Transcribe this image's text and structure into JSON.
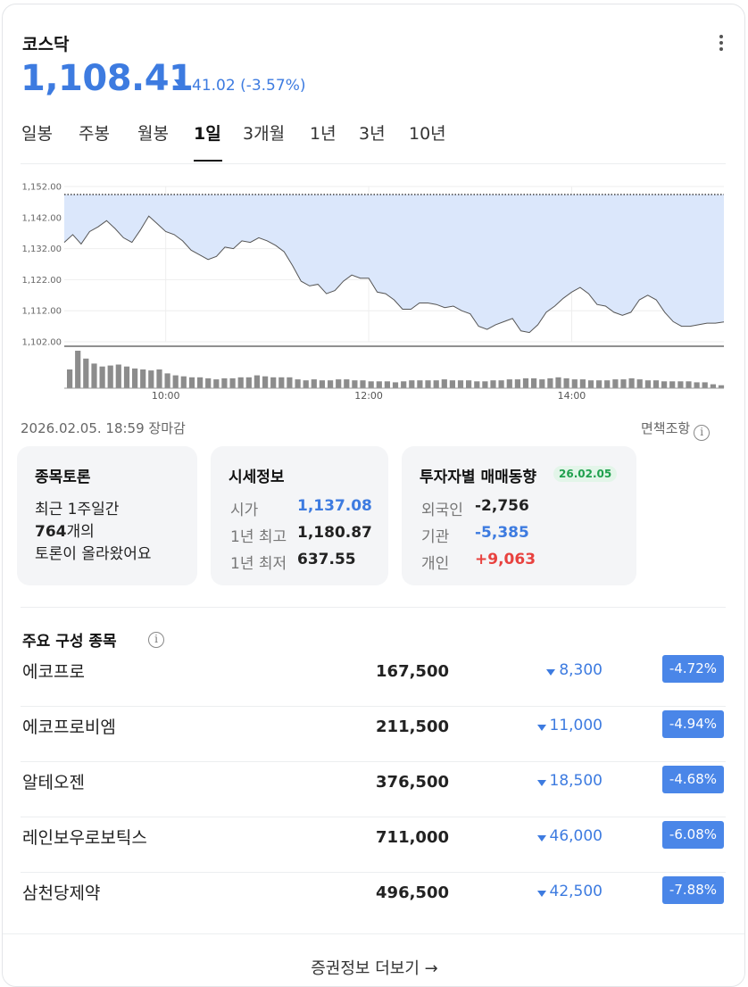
{
  "header": {
    "title": "코스닥",
    "price": "1,108.41",
    "change": "41.02 (-3.57%)",
    "direction": "down"
  },
  "tabs": [
    {
      "label": "일봉",
      "active": false
    },
    {
      "label": "주봉",
      "active": false
    },
    {
      "label": "월봉",
      "active": false
    },
    {
      "label": "1일",
      "active": true
    },
    {
      "label": "3개월",
      "active": false
    },
    {
      "label": "1년",
      "active": false
    },
    {
      "label": "3년",
      "active": false
    },
    {
      "label": "10년",
      "active": false
    }
  ],
  "chart_data": {
    "type": "area",
    "title": "",
    "y_ticks": [
      "1,152.00",
      "1,142.00",
      "1,132.00",
      "1,122.00",
      "1,112.00",
      "1,102.00"
    ],
    "ylim": [
      1102,
      1152
    ],
    "x_ticks": [
      "10:00",
      "12:00",
      "14:00"
    ],
    "reference_line": 1149.43,
    "price_series": [
      {
        "t": "09:00",
        "v": 1134.0
      },
      {
        "t": "09:05",
        "v": 1136.5
      },
      {
        "t": "09:10",
        "v": 1133.5
      },
      {
        "t": "09:15",
        "v": 1137.5
      },
      {
        "t": "09:20",
        "v": 1139.0
      },
      {
        "t": "09:25",
        "v": 1141.0
      },
      {
        "t": "09:30",
        "v": 1138.5
      },
      {
        "t": "09:35",
        "v": 1135.5
      },
      {
        "t": "09:40",
        "v": 1134.0
      },
      {
        "t": "09:45",
        "v": 1138.0
      },
      {
        "t": "09:50",
        "v": 1142.5
      },
      {
        "t": "09:55",
        "v": 1140.0
      },
      {
        "t": "10:00",
        "v": 1137.5
      },
      {
        "t": "10:05",
        "v": 1136.5
      },
      {
        "t": "10:10",
        "v": 1134.5
      },
      {
        "t": "10:15",
        "v": 1131.5
      },
      {
        "t": "10:20",
        "v": 1130.0
      },
      {
        "t": "10:25",
        "v": 1128.5
      },
      {
        "t": "10:30",
        "v": 1129.5
      },
      {
        "t": "10:35",
        "v": 1132.5
      },
      {
        "t": "10:40",
        "v": 1132.0
      },
      {
        "t": "10:45",
        "v": 1134.5
      },
      {
        "t": "10:50",
        "v": 1134.0
      },
      {
        "t": "10:55",
        "v": 1135.5
      },
      {
        "t": "11:00",
        "v": 1134.5
      },
      {
        "t": "11:05",
        "v": 1133.0
      },
      {
        "t": "11:10",
        "v": 1131.0
      },
      {
        "t": "11:15",
        "v": 1126.5
      },
      {
        "t": "11:20",
        "v": 1121.5
      },
      {
        "t": "11:25",
        "v": 1120.0
      },
      {
        "t": "11:30",
        "v": 1120.5
      },
      {
        "t": "11:35",
        "v": 1117.5
      },
      {
        "t": "11:40",
        "v": 1118.5
      },
      {
        "t": "11:45",
        "v": 1121.5
      },
      {
        "t": "11:50",
        "v": 1123.5
      },
      {
        "t": "11:55",
        "v": 1122.5
      },
      {
        "t": "12:00",
        "v": 1122.5
      },
      {
        "t": "12:05",
        "v": 1118.0
      },
      {
        "t": "12:10",
        "v": 1117.5
      },
      {
        "t": "12:15",
        "v": 1115.5
      },
      {
        "t": "12:20",
        "v": 1112.5
      },
      {
        "t": "12:25",
        "v": 1112.5
      },
      {
        "t": "12:30",
        "v": 1114.5
      },
      {
        "t": "12:35",
        "v": 1114.5
      },
      {
        "t": "12:40",
        "v": 1114.0
      },
      {
        "t": "12:45",
        "v": 1113.0
      },
      {
        "t": "12:50",
        "v": 1113.5
      },
      {
        "t": "12:55",
        "v": 1112.0
      },
      {
        "t": "13:00",
        "v": 1111.0
      },
      {
        "t": "13:05",
        "v": 1107.0
      },
      {
        "t": "13:10",
        "v": 1106.0
      },
      {
        "t": "13:15",
        "v": 1107.5
      },
      {
        "t": "13:20",
        "v": 1108.5
      },
      {
        "t": "13:25",
        "v": 1109.5
      },
      {
        "t": "13:30",
        "v": 1105.5
      },
      {
        "t": "13:35",
        "v": 1105.0
      },
      {
        "t": "13:40",
        "v": 1107.5
      },
      {
        "t": "13:45",
        "v": 1111.5
      },
      {
        "t": "13:50",
        "v": 1113.5
      },
      {
        "t": "13:55",
        "v": 1116.0
      },
      {
        "t": "14:00",
        "v": 1118.0
      },
      {
        "t": "14:05",
        "v": 1119.5
      },
      {
        "t": "14:10",
        "v": 1117.5
      },
      {
        "t": "14:15",
        "v": 1114.0
      },
      {
        "t": "14:20",
        "v": 1113.5
      },
      {
        "t": "14:25",
        "v": 1111.5
      },
      {
        "t": "14:30",
        "v": 1110.5
      },
      {
        "t": "14:35",
        "v": 1111.5
      },
      {
        "t": "14:40",
        "v": 1115.5
      },
      {
        "t": "14:45",
        "v": 1117.0
      },
      {
        "t": "14:50",
        "v": 1115.5
      },
      {
        "t": "14:55",
        "v": 1111.5
      },
      {
        "t": "15:00",
        "v": 1108.5
      },
      {
        "t": "15:05",
        "v": 1107.0
      },
      {
        "t": "15:10",
        "v": 1107.0
      },
      {
        "t": "15:15",
        "v": 1107.5
      },
      {
        "t": "15:20",
        "v": 1108.0
      },
      {
        "t": "15:25",
        "v": 1108.0
      },
      {
        "t": "15:30",
        "v": 1108.41
      }
    ],
    "volume_series": [
      19,
      38,
      30,
      25,
      22,
      23,
      24,
      22,
      20,
      19,
      18,
      19,
      15,
      13,
      12,
      11,
      11,
      10,
      9,
      10,
      10,
      11,
      11,
      13,
      12,
      11,
      11,
      11,
      9,
      8,
      9,
      8,
      8,
      9,
      9,
      8,
      8,
      7,
      7,
      7,
      6,
      7,
      8,
      8,
      8,
      8,
      9,
      8,
      8,
      8,
      7,
      7,
      8,
      8,
      9,
      9,
      10,
      10,
      9,
      10,
      11,
      10,
      9,
      9,
      8,
      8,
      8,
      9,
      9,
      10,
      9,
      8,
      8,
      7,
      7,
      7,
      7,
      6,
      6,
      4,
      3
    ]
  },
  "status": {
    "timestamp": "2026.02.05. 18:59 장마감",
    "disclaimer": "면책조항",
    "info_glyph": "i"
  },
  "discussion": {
    "title": "종목토론",
    "line1": "최근 1주일간",
    "count": "764",
    "count_suffix": "개의",
    "line3": "토론이 올라왔어요"
  },
  "quote_info": {
    "title": "시세정보",
    "rows": [
      {
        "label": "시가",
        "value": "1,137.08",
        "color": "blue"
      },
      {
        "label": "1년 최고",
        "value": "1,180.87",
        "color": "default"
      },
      {
        "label": "1년 최저",
        "value": "637.55",
        "color": "default"
      }
    ]
  },
  "investor_trend": {
    "title": "투자자별 매매동향",
    "date": "26.02.05",
    "rows": [
      {
        "label": "외국인",
        "value": "-2,756",
        "color": "default"
      },
      {
        "label": "기관",
        "value": "-5,385",
        "color": "blue"
      },
      {
        "label": "개인",
        "value": "+9,063",
        "color": "red"
      }
    ]
  },
  "components": {
    "title": "주요 구성 종목",
    "rows": [
      {
        "name": "에코프로",
        "price": "167,500",
        "change": "8,300",
        "pct": "-4.72%"
      },
      {
        "name": "에코프로비엠",
        "price": "211,500",
        "change": "11,000",
        "pct": "-4.94%"
      },
      {
        "name": "알테오젠",
        "price": "376,500",
        "change": "18,500",
        "pct": "-4.68%"
      },
      {
        "name": "레인보우로보틱스",
        "price": "711,000",
        "change": "46,000",
        "pct": "-6.08%"
      },
      {
        "name": "삼천당제약",
        "price": "496,500",
        "change": "42,500",
        "pct": "-7.88%"
      }
    ]
  },
  "footer": {
    "label": "증권정보 더보기",
    "arrow": "→"
  },
  "colors": {
    "down": "#3d7be0",
    "up": "#e8423f",
    "area_fill": "#dbe7fb",
    "area_line": "#555555",
    "volume_bar": "#8c8c8c"
  }
}
